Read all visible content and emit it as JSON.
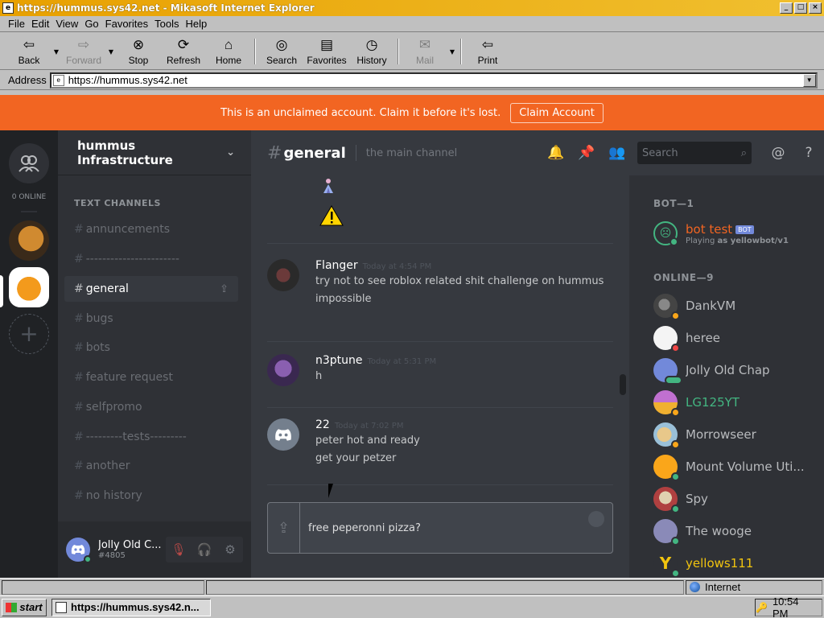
{
  "window": {
    "title": "https://hummus.sys42.net - Mikasoft Internet Explorer",
    "controls": [
      "_",
      "□",
      "×"
    ]
  },
  "menu": [
    "File",
    "Edit",
    "View",
    "Go",
    "Favorites",
    "Tools",
    "Help"
  ],
  "toolbar": {
    "back": "Back",
    "forward": "Forward",
    "stop": "Stop",
    "refresh": "Refresh",
    "home": "Home",
    "search": "Search",
    "favorites": "Favorites",
    "history": "History",
    "mail": "Mail",
    "print": "Print"
  },
  "address": {
    "label": "Address",
    "url": "https://hummus.sys42.net"
  },
  "banner": {
    "text": "This is an unclaimed account. Claim it before it's lost.",
    "button": "Claim Account"
  },
  "guilds": {
    "online_count": "0 ONLINE"
  },
  "server": {
    "name": "hummus Infrastructure",
    "section": "TEXT CHANNELS",
    "channels": [
      "annuncements",
      "-----------------------",
      "general",
      "bugs",
      "bots",
      "feature request",
      "selfpromo",
      "---------tests---------",
      "another",
      "no history"
    ]
  },
  "user": {
    "name": "Jolly Old C...",
    "discriminator": "#4805"
  },
  "chat": {
    "channel": "general",
    "topic": "the main channel",
    "search_placeholder": "Search",
    "messages": [
      {
        "author": "Flanger",
        "time": "Today at 4:54 PM",
        "lines": [
          "try not to see roblox related shit challenge on hummus",
          "impossible"
        ]
      },
      {
        "author": "n3ptune",
        "time": "Today at 5:31 PM",
        "lines": [
          "h"
        ]
      },
      {
        "author": "22",
        "time": "Today at 7:02 PM",
        "lines": [
          "peter hot and ready",
          "get your petzer"
        ]
      }
    ],
    "composer_value": "free peperonni pizza?"
  },
  "members": {
    "bot_section": "BOT—1",
    "bot": {
      "name": "bot test",
      "tag": "BOT",
      "activity_prefix": "Playing",
      "activity": "as yellowbot/v1"
    },
    "online_section": "ONLINE—9",
    "online": [
      {
        "name": "DankVM",
        "color": "#b9bbbe"
      },
      {
        "name": "heree",
        "color": "#b9bbbe"
      },
      {
        "name": "Jolly Old Chap",
        "color": "#b9bbbe"
      },
      {
        "name": "LG125YT",
        "color": "#43b581"
      },
      {
        "name": "Morrowseer",
        "color": "#b9bbbe"
      },
      {
        "name": "Mount Volume Uti...",
        "color": "#b9bbbe"
      },
      {
        "name": "Spy",
        "color": "#b9bbbe"
      },
      {
        "name": "The wooge",
        "color": "#b9bbbe"
      },
      {
        "name": "yellows111",
        "color": "#f1c40f"
      }
    ]
  },
  "statusbar": {
    "zone": "Internet"
  },
  "taskbar": {
    "start": "start",
    "app": "https://hummus.sys42.n...",
    "time": "10:54 PM"
  }
}
